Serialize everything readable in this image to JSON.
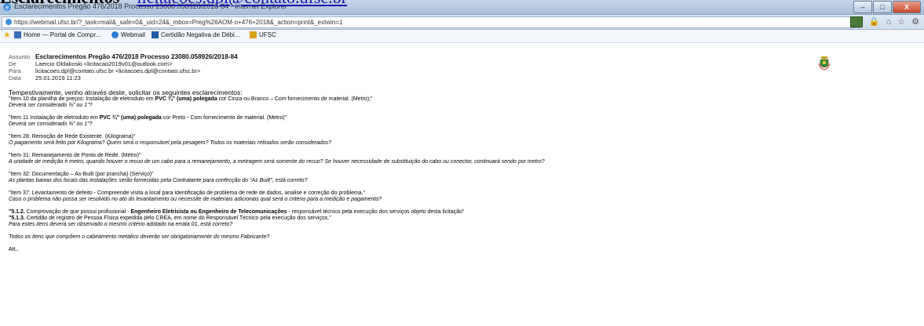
{
  "overflow_heading": {
    "text": "Esclarecimentos",
    "link": "licitacoes.dpl@contato.ufsc.br"
  },
  "window": {
    "title": "Esclarecimentos Pregão 476/2018 Processo 23080.058926/2018-84 - Internet Explorer"
  },
  "address_bar": {
    "url": "https://webmail.ufsc.br/?_task=mail&_safe=0&_uid=24&_mbox=Preg%26AOM-o+476+2018&_action=print&_extwin=1"
  },
  "favorites": [
    {
      "label": "Home — Portal de Compr...",
      "color": "#3a6fb6"
    },
    {
      "label": "Webmail",
      "color": "#2c7bd1"
    },
    {
      "label": "Certidão Negativa de Débi...",
      "color": "#1f5aa8"
    },
    {
      "label": "UFSC",
      "color": "#d9a21b"
    }
  ],
  "email": {
    "labels": {
      "subject": "Assunto",
      "from": "De",
      "to": "Para",
      "date": "Data"
    },
    "subject": "Esclarecimentos Pregão 476/2018 Processo 23080.058926/2018-84",
    "from": "Laercio Oldakoski <licitacao2019v01@outlook.com>",
    "to": "licitacoes.dpl@contato.ufsc.br <licitacoes.dpl@contato.ufsc.br>",
    "date": "25.01.2019 11:23"
  },
  "body": {
    "intro": "Tempestivamente, venho através deste, solicitar os seguintes esclarecimentos:",
    "item10": {
      "pre": "\"Item 10 da planilha de preços: Instalação de eletroduto em ",
      "bold": "PVC ¾\" (uma) polegada",
      "post": " cor Cinza ou Branco – Com fornecimento de material. (Metro);\"",
      "q": "Deverá ser considerado ¾\" ou 1\"?"
    },
    "item11": {
      "pre": "\"Item 11 Instalação de eletroduto em ",
      "bold": "PVC ¾\" (uma) polegada",
      "post": " cor Preto - Com fornecimento de material. (Metro)\"",
      "q": "Deverá ser considerado ¾\" ou 1\"?"
    },
    "item28": {
      "text": "\"Item 28: Remoção de Rede Existente. (Kilograma)\"",
      "q": "O pagamento será feito por Kilograma? Quem será o responsável pela pesagem? Todos os materiais retirados serão considerados?"
    },
    "item31": {
      "text": "\"Item 31: Remanejamento de Ponto de Rede. (Metro)\"",
      "q": "A unidade de medição é metro, quando houver o recuo de um cabo para o remanejamento, a metragem será somente do recuo? Se houver necessidade de substituição do cabo ou conector, continuará sendo por metro?"
    },
    "item32": {
      "text": "\"Item 32: Documentação – As-Built (por prancha) (Serviço)\"",
      "q": "As plantas baixas dos locais das instalações serão fornecidas pela Contratante para confecção do \"As Built\", está correto?"
    },
    "item37": {
      "text": "\"Item 37: Levantamento de defeito - Compreende visita a local para identificação de problema de rede de dados, analise e correção do problema.\"",
      "q": "Caso o problema não possa ser resolvido no ato do levantamento ou necessite de materiais adicionais qual será o critério para a medição e pagamento?"
    },
    "item512": {
      "num": "\"5.1.2.",
      "pre": " Comprovação de que possui profissional - ",
      "bold": "Engenheiro Eletricista ou Engenheiro de Telecomunicações",
      "post": " - responsável técnico pela execução dos serviços objeto desta licitação\""
    },
    "item513": {
      "num": "\"5.1.3.",
      "post": " Certidão de registro de Pessoa Física expedida pelo CREA, em nome do Responsável Técnico pela execução dos serviços.\"",
      "q": "Para estes itens deverá ser observado o mesmo critério adotado na errata 01, está correto?"
    },
    "final_q": "Todos os itens que compõem o cabeamento metálico deverão ser obrigatoriamente do mesmo Fabricante?",
    "signoff": "Att.,"
  }
}
